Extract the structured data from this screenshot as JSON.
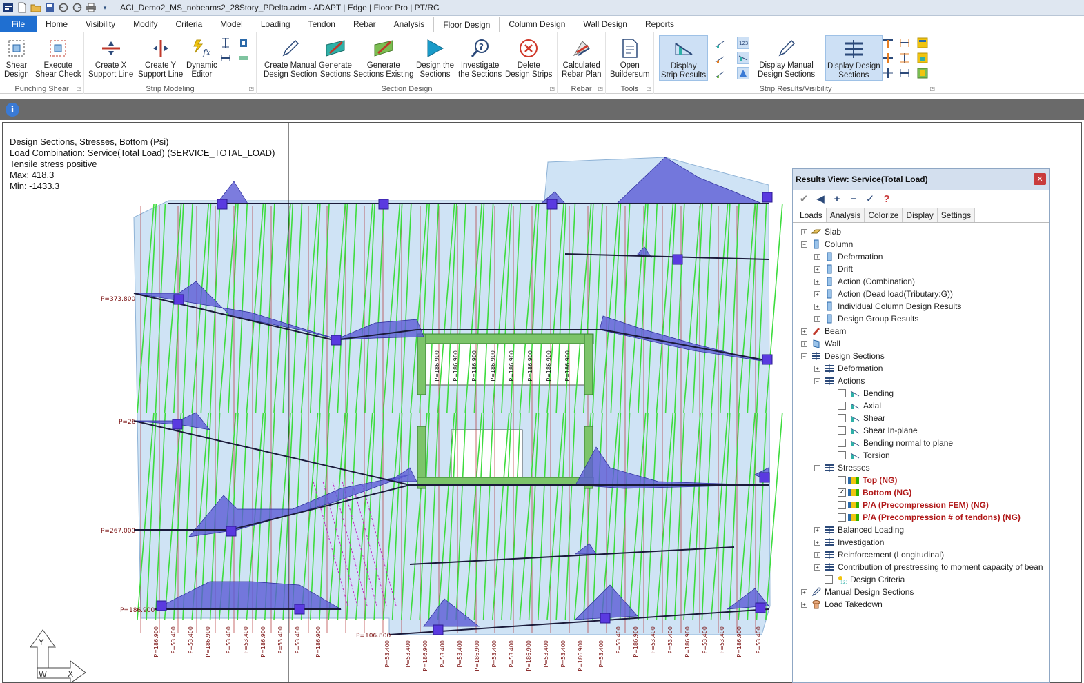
{
  "window": {
    "title": "ACI_Demo2_MS_nobeams2_28Story_PDelta.adm - ADAPT | Edge | Floor Pro | PT/RC"
  },
  "tabs": [
    {
      "label": "File"
    },
    {
      "label": "Home"
    },
    {
      "label": "Visibility"
    },
    {
      "label": "Modify"
    },
    {
      "label": "Criteria"
    },
    {
      "label": "Model"
    },
    {
      "label": "Loading"
    },
    {
      "label": "Tendon"
    },
    {
      "label": "Rebar"
    },
    {
      "label": "Analysis"
    },
    {
      "label": "Floor Design"
    },
    {
      "label": "Column Design"
    },
    {
      "label": "Wall Design"
    },
    {
      "label": "Reports"
    }
  ],
  "active_tab": "Floor Design",
  "ribbon": {
    "groups": {
      "punching": "Punching Shear",
      "strip": "Strip Modeling",
      "section": "Section Design",
      "rebar": "Rebar",
      "tools": "Tools",
      "results": "Strip Results/Visibility"
    },
    "buttons": {
      "shear_design": [
        "Shear",
        "Design"
      ],
      "execute_shear": [
        "Execute",
        "Shear Check"
      ],
      "create_x": [
        "Create X",
        "Support Line"
      ],
      "create_y": [
        "Create Y",
        "Support Line"
      ],
      "dynamic_editor": [
        "Dynamic",
        "Editor"
      ],
      "create_manual": [
        "Create Manual",
        "Design Section"
      ],
      "generate": [
        "Generate",
        "Sections"
      ],
      "generate_existing": [
        "Generate",
        "Sections Existing"
      ],
      "design_sections": [
        "Design the",
        "Sections"
      ],
      "investigate": [
        "Investigate",
        "the Sections"
      ],
      "delete_strips": [
        "Delete",
        "Design Strips"
      ],
      "calc_rebar": [
        "Calculated",
        "Rebar Plan"
      ],
      "open_buildersum": [
        "Open",
        "Buildersum"
      ],
      "display_strip": [
        "Display",
        "Strip Results"
      ],
      "display_manual": [
        "Display Manual",
        "Design Sections"
      ],
      "display_design": [
        "Display Design",
        "Sections"
      ]
    }
  },
  "overlay": {
    "line1": "Design Sections, Stresses, Bottom (Psi)",
    "line2": "Load Combination: Service(Total Load) (SERVICE_TOTAL_LOAD)",
    "line3": "Tensile stress positive",
    "line4": "Max: 418.3",
    "line5": "Min: -1433.3"
  },
  "canvas_labels": {
    "p1": "P=373.800",
    "p2": "P=26",
    "p3": "P=267.000",
    "p4": "P=186.900",
    "p5": "P=106.800",
    "p6": "P=53.400",
    "p7": "P=186.900"
  },
  "results_panel": {
    "title": "Results View: Service(Total Load)",
    "tabs": [
      "Loads",
      "Analysis",
      "Colorize",
      "Display",
      "Settings"
    ],
    "tree": {
      "slab": "Slab",
      "column": "Column",
      "col_deformation": "Deformation",
      "col_drift": "Drift",
      "col_action_comb": "Action (Combination)",
      "col_action_dead": "Action (Dead load(Tributary:G))",
      "col_individual": "Individual Column Design Results",
      "col_group": "Design Group Results",
      "beam": "Beam",
      "wall": "Wall",
      "design_sections": "Design Sections",
      "ds_deformation": "Deformation",
      "ds_actions": "Actions",
      "act_bending": "Bending",
      "act_axial": "Axial",
      "act_shear": "Shear",
      "act_shear_inplane": "Shear In-plane",
      "act_bending_normal": "Bending normal to plane",
      "act_torsion": "Torsion",
      "ds_stresses": "Stresses",
      "st_top": "Top (NG)",
      "st_bottom": "Bottom (NG)",
      "st_pa_fem": "P/A (Precompression FEM) (NG)",
      "st_pa_tendons": "P/A (Precompression # of tendons) (NG)",
      "ds_balanced": "Balanced Loading",
      "ds_investigation": "Investigation",
      "ds_reinforcement": "Reinforcement (Longitudinal)",
      "ds_contribution": "Contribution of prestressing to moment capacity of bean",
      "ds_criteria": "Design Criteria",
      "manual_sections": "Manual Design Sections",
      "load_takedown": "Load Takedown"
    }
  },
  "colors": {
    "accent": "#1f6fd1",
    "strip_green": "#3ddc3d",
    "stress_blue": "#5b5bd6",
    "slab_fill": "#cfe3f5",
    "ng_red": "#b01717"
  }
}
